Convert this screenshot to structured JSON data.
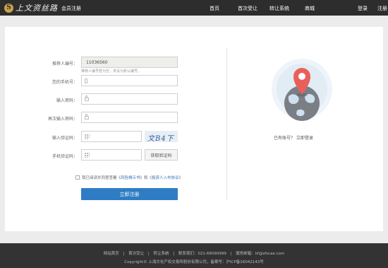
{
  "header": {
    "logo_letter": "S",
    "logo_text": "上文资丝路",
    "page_title": "会员注册",
    "nav": [
      "首页",
      "首次受让",
      "转让系统",
      "商城"
    ],
    "login": "登录",
    "register": "注册"
  },
  "form": {
    "referrer_label": "推荐人编号：",
    "referrer_value": "11036560",
    "referrer_hint": "推荐人编号若为空，将设为默认编号。",
    "phone_label": "您的手机号：",
    "password_label": "输入密码：",
    "password_confirm_label": "再次输入密码：",
    "captcha_label": "输入验证码：",
    "captcha_text": "文B4下在",
    "sms_label": "手机验证码：",
    "sms_button": "获取验证码",
    "agree_prefix": "我已阅读并同意签署《",
    "agree_link1": "风险揭示书",
    "agree_mid": "》和《",
    "agree_link2": "投资人入市协议",
    "agree_suffix": "》",
    "submit": "立即注册"
  },
  "side": {
    "login_prompt": "已有账号？",
    "login_link": "立即登录"
  },
  "footer": {
    "links": [
      "网站首页",
      "|",
      "首次受让",
      "|",
      "转让系统",
      "|",
      "联系我们：021-66090999",
      "|",
      "服务邮箱：kf@sfscae.com"
    ],
    "copyright": "Copyright© 上海文化产权交易所股份有限公司，备案号：沪ICP备16042143号"
  },
  "colors": {
    "topbar": "#2d2d2d",
    "primary_button": "#2e7cc4",
    "link": "#2f6fb5",
    "pin": "#e9605a",
    "footer": "#333333"
  }
}
